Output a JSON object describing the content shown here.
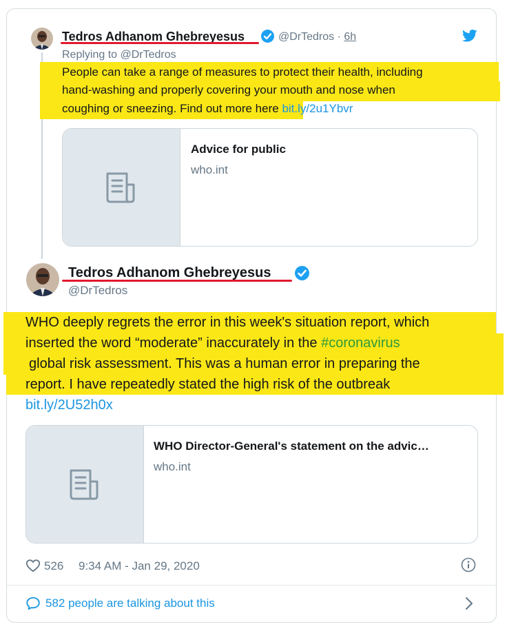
{
  "tweet1": {
    "name": "Tedros Adhanom Ghebreyesus",
    "handle": "@DrTedros",
    "sep": "·",
    "time": "6h",
    "replying": "Replying to @DrTedros",
    "lines": [
      "People can take a range of measures to protect their health, including",
      "hand-washing and properly covering your mouth and nose when",
      "coughing or sneezing. Find out more here"
    ],
    "link": "bit.ly/2u1Ybvr",
    "card": {
      "title": "Advice for public",
      "domain": "who.int",
      "icon": "document-icon"
    }
  },
  "tweet2": {
    "name": "Tedros Adhanom Ghebreyesus",
    "handle": "@DrTedros",
    "line1": "WHO deeply regrets the error in this week's situation report, which",
    "line2_pre": "inserted the word “moderate” inaccurately in the",
    "hashtag": "#coronavirus",
    "line3": "global risk assessment. This was a human error in preparing the",
    "line4": "report. I have repeatedly stated the high risk of the outbreak",
    "link": "bit.ly/2U52h0x",
    "card": {
      "title": "WHO Director-General's statement on the advic…",
      "domain": "who.int",
      "icon": "document-icon"
    },
    "likes": "526",
    "timestamp": "9:34 AM - Jan 29, 2020"
  },
  "footer": {
    "talking": "582 people are talking about this"
  },
  "colors": {
    "twitter_blue": "#1da1f2",
    "highlight": "#fbe716",
    "underline": "#e0182d",
    "hashtag": "#2e9a3a"
  }
}
